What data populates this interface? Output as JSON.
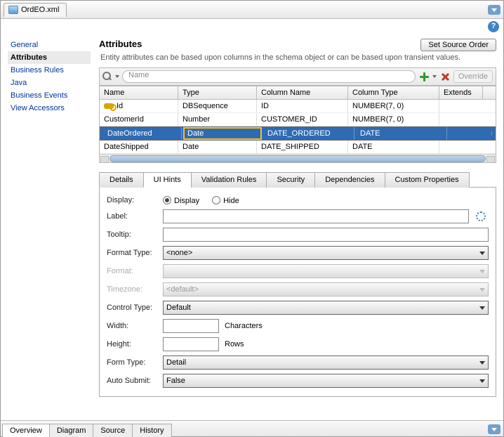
{
  "window": {
    "tab_title": "OrdEO.xml"
  },
  "sidenav": {
    "items": [
      {
        "label": "General"
      },
      {
        "label": "Attributes",
        "active": true
      },
      {
        "label": "Business Rules"
      },
      {
        "label": "Java"
      },
      {
        "label": "Business Events"
      },
      {
        "label": "View Accessors"
      }
    ]
  },
  "page": {
    "heading": "Attributes",
    "subtext": "Entity attributes can be based upon columns in the schema object or can be based upon transient values.",
    "set_source_order": "Set Source Order"
  },
  "search": {
    "placeholder": "Name",
    "override": "Override"
  },
  "grid": {
    "columns": [
      "Name",
      "Type",
      "Column Name",
      "Column Type",
      "Extends"
    ],
    "rows": [
      {
        "key": true,
        "sel": false,
        "cells": [
          "Id",
          "DBSequence",
          "ID",
          "NUMBER(7, 0)",
          ""
        ]
      },
      {
        "key": false,
        "sel": false,
        "cells": [
          "CustomerId",
          "Number",
          "CUSTOMER_ID",
          "NUMBER(7, 0)",
          ""
        ]
      },
      {
        "key": false,
        "sel": true,
        "cells": [
          "DateOrdered",
          "Date",
          "DATE_ORDERED",
          "DATE",
          ""
        ]
      },
      {
        "key": false,
        "sel": false,
        "cells": [
          "DateShipped",
          "Date",
          "DATE_SHIPPED",
          "DATE",
          ""
        ]
      }
    ]
  },
  "tabs": [
    {
      "label": "Details"
    },
    {
      "label": "UI Hints",
      "active": true
    },
    {
      "label": "Validation Rules"
    },
    {
      "label": "Security"
    },
    {
      "label": "Dependencies"
    },
    {
      "label": "Custom Properties"
    }
  ],
  "form": {
    "display_label": "Display:",
    "display_opt1": "Display",
    "display_opt2": "Hide",
    "label_label": "Label:",
    "label_value": "",
    "tooltip_label": "Tooltip:",
    "tooltip_value": "",
    "formattype_label": "Format Type:",
    "formattype_value": "<none>",
    "format_label": "Format:",
    "format_value": "",
    "timezone_label": "Timezone:",
    "timezone_value": "<default>",
    "controltype_label": "Control Type:",
    "controltype_value": "Default",
    "width_label": "Width:",
    "width_unit": "Characters",
    "height_label": "Height:",
    "height_unit": "Rows",
    "formtype_label": "Form Type:",
    "formtype_value": "Detail",
    "autosubmit_label": "Auto Submit:",
    "autosubmit_value": "False"
  },
  "bottom_tabs": [
    {
      "label": "Overview",
      "active": true
    },
    {
      "label": "Diagram"
    },
    {
      "label": "Source"
    },
    {
      "label": "History"
    }
  ]
}
